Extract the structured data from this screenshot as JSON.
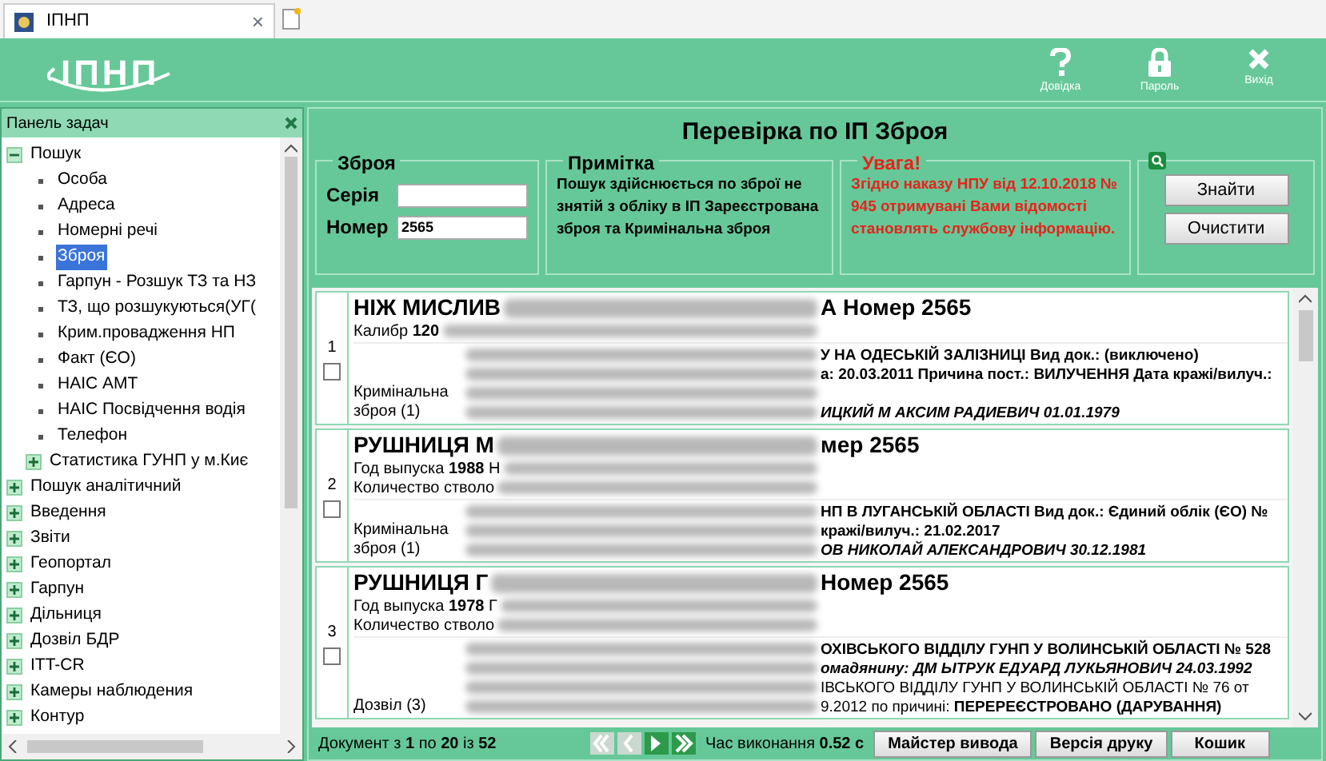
{
  "browser_tab": {
    "title": "ІПНП",
    "close": "×"
  },
  "header": {
    "logo": "ІПНП",
    "actions": [
      {
        "kind": "help",
        "label": "Довідка"
      },
      {
        "kind": "lock",
        "label": "Пароль"
      },
      {
        "kind": "exit",
        "label": "Вихід"
      }
    ]
  },
  "sidebar": {
    "title": "Панель задач",
    "tree": [
      {
        "label": "Пошук",
        "expanded": true,
        "selected": false,
        "children": [
          {
            "label": "Особа",
            "selected": false
          },
          {
            "label": "Адреса",
            "selected": false
          },
          {
            "label": "Номерні речі",
            "selected": false
          },
          {
            "label": "Зброя",
            "selected": true
          },
          {
            "label": "Гарпун - Розшук ТЗ та НЗ",
            "selected": false
          },
          {
            "label": "ТЗ, що розшукуються(УГ(",
            "selected": false
          },
          {
            "label": "Крим.провадження НП",
            "selected": false
          },
          {
            "label": "Факт (ЄО)",
            "selected": false
          },
          {
            "label": "НАІС АМТ",
            "selected": false
          },
          {
            "label": "НАІС Посвідчення водія",
            "selected": false
          },
          {
            "label": "Телефон",
            "selected": false
          },
          {
            "label": "Статистика ГУНП у м.Киє",
            "expanded": false,
            "selected": false
          }
        ]
      },
      {
        "label": "Пошук аналітичний",
        "expanded": false,
        "selected": false
      },
      {
        "label": "Введення",
        "expanded": false,
        "selected": false
      },
      {
        "label": "Звіти",
        "expanded": false,
        "selected": false
      },
      {
        "label": "Геопортал",
        "expanded": false,
        "selected": false
      },
      {
        "label": "Гарпун",
        "expanded": false,
        "selected": false
      },
      {
        "label": "Дільниця",
        "expanded": false,
        "selected": false
      },
      {
        "label": "Дозвіл БДР",
        "expanded": false,
        "selected": false
      },
      {
        "label": "ITT-CR",
        "expanded": false,
        "selected": false
      },
      {
        "label": "Камеры наблюдения",
        "expanded": false,
        "selected": false
      },
      {
        "label": "Контур",
        "expanded": false,
        "selected": false
      }
    ]
  },
  "form": {
    "title": "Перевірка по ІП Зброя",
    "weapon": {
      "legend": "Зброя",
      "fields": [
        {
          "label": "Серія"
        },
        {
          "label": "Номер",
          "value": "2565"
        }
      ]
    },
    "note": {
      "legend": "Примітка",
      "text": "Пошук здійснюється по зброї не знятій з обліку в ІП Зареєстрована зброя та Кримінальна зброя"
    },
    "warning": {
      "legend": "Увага!",
      "text": "Згідно наказу НПУ від 12.10.2018 № 945 отримувані Вами відомості становлять службову інформацію."
    },
    "buttons": [
      "Знайти",
      "Очистити"
    ]
  },
  "results": [
    {
      "number": "1",
      "checked": false,
      "title": [
        "НІЖ МИСЛИВ",
        "А Номер 2565"
      ],
      "attributes": [
        "Калибр **120**"
      ],
      "section": "Кримінальна зброя (1)",
      "details": [
        {
          "kind": "text",
          "text": "У НА ОДЕСЬКІЙ ЗАЛІЗНИЦІ Вид док.: (виключено)"
        },
        {
          "kind": "text",
          "text": "а: 20.03.2011 Причина пост.: ВИЛУЧЕННЯ Дата крaжі/вилуч.:"
        },
        {
          "kind": "redacted"
        },
        {
          "kind": "italic",
          "text": "ИЦКИЙ М АКСИМ РАДИЕВИЧ 01.01.1979"
        }
      ]
    },
    {
      "number": "2",
      "checked": false,
      "title": [
        "РУШНИЦЯ М",
        "мер 2565"
      ],
      "attributes": [
        "Год выпуска **1988** Н",
        "Количество стволо"
      ],
      "section": "Кримінальна зброя (1)",
      "details": [
        {
          "kind": "text",
          "text": "НП В ЛУГАНСЬКІЙ ОБЛАСТІ Вид док.: Єдиний облік (ЄО) №"
        },
        {
          "kind": "text",
          "text": "кражі/вилуч.: 21.02.2017"
        },
        {
          "kind": "italic",
          "text": "ОВ НИКОЛАЙ АЛЕКСАНДРОВИЧ 30.12.1981"
        }
      ]
    },
    {
      "number": "3",
      "checked": false,
      "title": [
        "РУШНИЦЯ Г",
        "Номер 2565"
      ],
      "attributes": [
        "Год выпуска **1978** Г",
        "Количество стволо"
      ],
      "section": "Дозвіл (3)",
      "details": [
        {
          "kind": "text",
          "text": "ОХІВСЬКОГО ВІДДІЛУ ГУНП У ВОЛИНСЬКІЙ ОБЛАСТІ № 528"
        },
        {
          "kind": "italic",
          "text": "омадянину: ДМ ЫТРУК ЕДУАРД ЛУКЬЯНОВИЧ 24.03.1992"
        },
        {
          "kind": "plain",
          "text": "ІВСЬКОГО ВІДДІЛУ ГУНП У ВОЛИНСЬКІЙ ОБЛАСТІ № 76 от"
        },
        {
          "kind": "plain",
          "text": "9.2012 по причині: **ПЕРЕРЕЄСТРОВАНО (ДАРУВАННЯ)**"
        }
      ]
    }
  ],
  "footer": {
    "range": "Документ з **1** по **20** із **52**",
    "nav": [
      {
        "kind": "first",
        "disabled": true
      },
      {
        "kind": "prev",
        "disabled": true
      },
      {
        "kind": "next",
        "disabled": false
      },
      {
        "kind": "last",
        "disabled": false
      }
    ],
    "time": "Час виконання **0.52 с**",
    "buttons": [
      "Майстер вивода",
      "Версія друку",
      "Кошик"
    ]
  }
}
